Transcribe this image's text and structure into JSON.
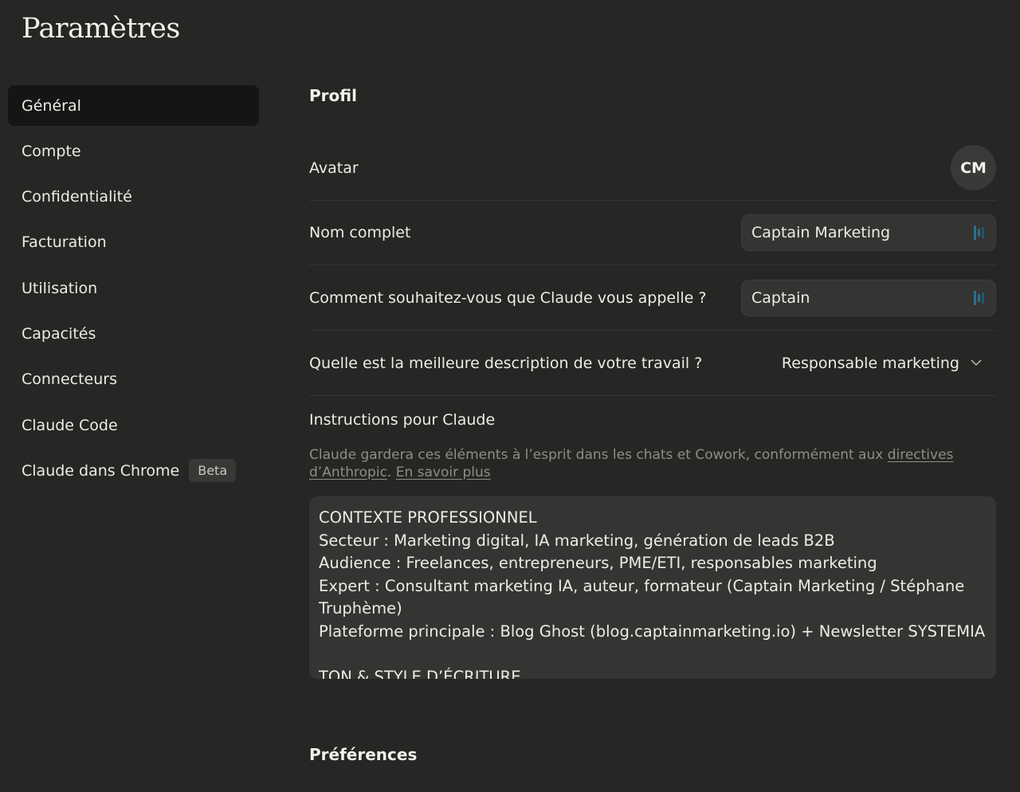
{
  "page": {
    "title": "Paramètres"
  },
  "sidebar": {
    "items": [
      {
        "label": "Général"
      },
      {
        "label": "Compte"
      },
      {
        "label": "Confidentialité"
      },
      {
        "label": "Facturation"
      },
      {
        "label": "Utilisation"
      },
      {
        "label": "Capacités"
      },
      {
        "label": "Connecteurs"
      },
      {
        "label": "Claude Code"
      },
      {
        "label": "Claude dans Chrome",
        "badge": "Beta"
      }
    ]
  },
  "profile": {
    "title": "Profil",
    "avatar_label": "Avatar",
    "avatar_initials": "CM",
    "full_name_label": "Nom complet",
    "full_name_value": "Captain Marketing",
    "nickname_label": "Comment souhaitez-vous que Claude vous appelle ?",
    "nickname_value": "Captain",
    "work_label": "Quelle est la meilleure description de votre travail ?",
    "work_value": "Responsable marketing",
    "instructions_title": "Instructions pour Claude",
    "instructions_desc_prefix": "Claude gardera ces éléments à l’esprit dans les chats et Cowork, conformément aux ",
    "instructions_desc_link": "directives d’Anthropic",
    "instructions_desc_sep": ". ",
    "instructions_learn_more": "En savoir plus",
    "instructions_text": "CONTEXTE PROFESSIONNEL\nSecteur : Marketing digital, IA marketing, génération de leads B2B\nAudience : Freelances, entrepreneurs, PME/ETI, responsables marketing\nExpert : Consultant marketing IA, auteur, formateur (Captain Marketing / Stéphane Truphème)\nPlateforme principale : Blog Ghost (blog.captainmarketing.io) + Newsletter SYSTEMIA\n\nTON & STYLE D’ÉCRITURE"
  },
  "preferences": {
    "title": "Préférences"
  },
  "colors": {
    "background": "#262624",
    "active_nav": "#151514",
    "field_bg": "#343432",
    "field_icon_accent": "#2b6f8c"
  }
}
